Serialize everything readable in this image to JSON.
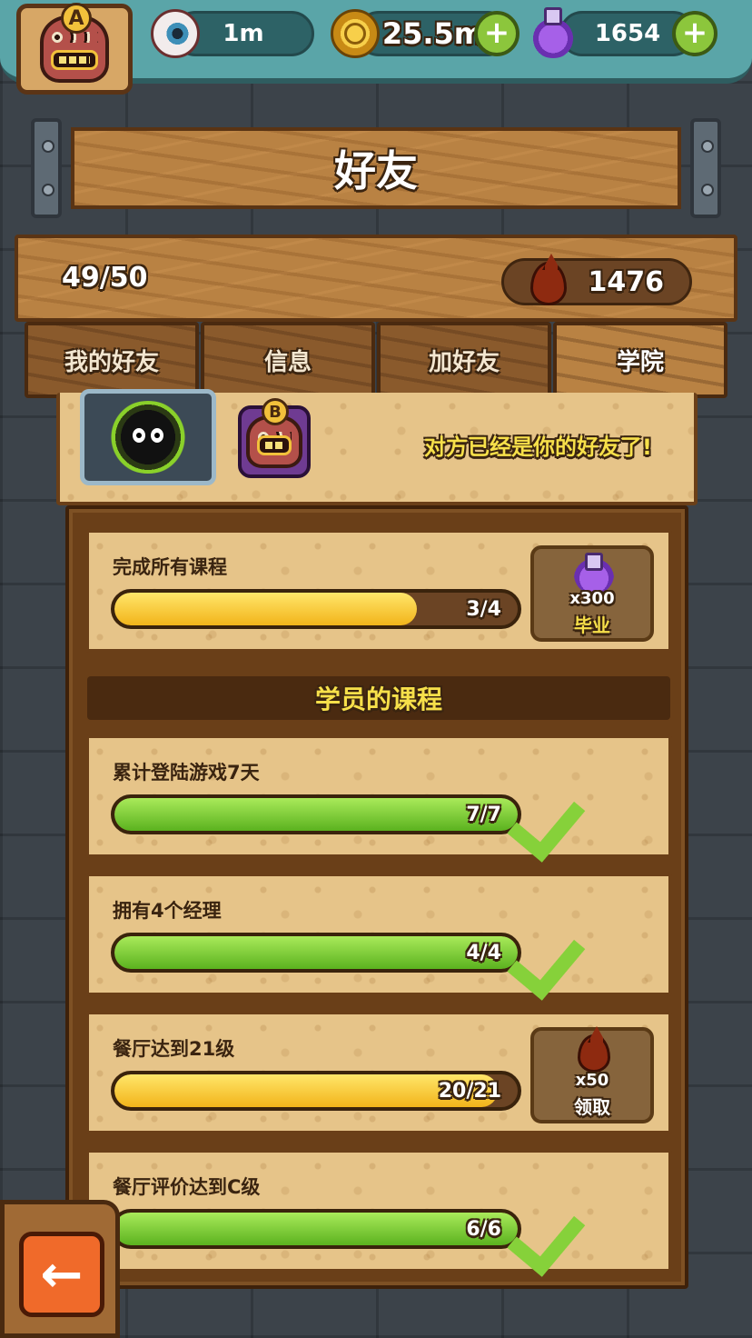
{
  "hud": {
    "player_grade": "A",
    "eyes_value": "1m",
    "coins_value": "25.5m",
    "potions_value": "1654"
  },
  "title": "好友",
  "stats": {
    "friend_count": "49/50",
    "blood_value": "1476"
  },
  "tabs": [
    {
      "label": "我的好友",
      "active": false
    },
    {
      "label": "信息",
      "active": false
    },
    {
      "label": "加好友",
      "active": false
    },
    {
      "label": "学院",
      "active": true
    }
  ],
  "friend_card": {
    "friend_grade": "B",
    "message": "对方已经是你的好友了!"
  },
  "graduation": {
    "title": "完成所有课程",
    "progress_label": "3/4",
    "progress": 0.75,
    "reward_qty": "x300",
    "reward_label": "毕业",
    "reward_icon": "potion-icon"
  },
  "section_title": "学员的课程",
  "courses": [
    {
      "title": "累计登陆游戏7天",
      "progress_label": "7/7",
      "progress": 1.0,
      "status": "complete",
      "bar_color": "green"
    },
    {
      "title": "拥有4个经理",
      "progress_label": "4/4",
      "progress": 1.0,
      "status": "complete",
      "bar_color": "green"
    },
    {
      "title": "餐厅达到21级",
      "progress_label": "20/21",
      "progress": 0.95,
      "status": "claimable",
      "bar_color": "yellow",
      "reward_qty": "x50",
      "reward_label": "领取",
      "reward_icon": "blood-drop-icon"
    },
    {
      "title": "餐厅评价达到C级",
      "progress_label": "6/6",
      "progress": 1.0,
      "status": "complete",
      "bar_color": "green"
    }
  ],
  "colors": {
    "wood": "#b98243",
    "paper": "#e6c489",
    "accent_yellow": "#f7e04a",
    "bar_green": "#86d13a",
    "bar_yellow": "#f2c13b",
    "hud_teal": "#5aa5a8"
  }
}
